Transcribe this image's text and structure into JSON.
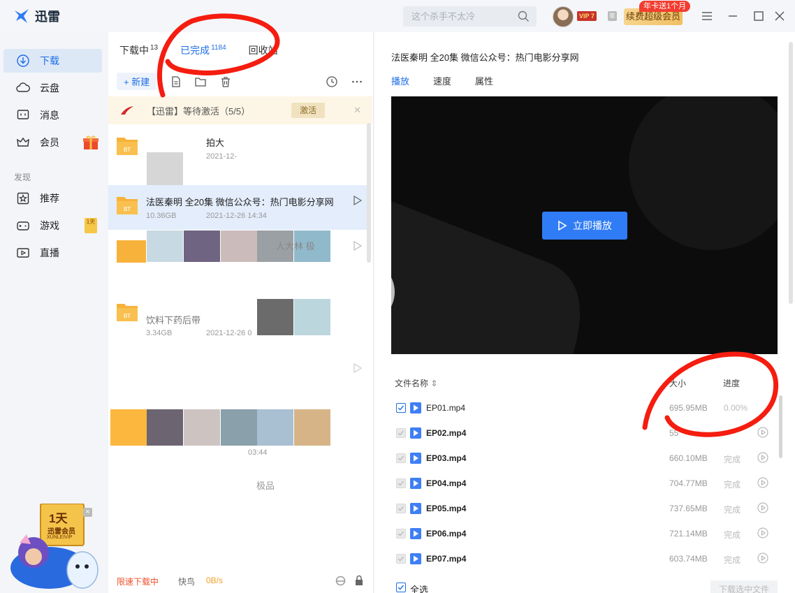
{
  "app": {
    "name": "迅雷"
  },
  "search": {
    "placeholder": "这个杀手不太冷"
  },
  "account": {
    "vip_label": "VIP 7",
    "year_label": "年",
    "renew_label": "续费超级会员",
    "promo_label": "年卡送1个月"
  },
  "sidebar": {
    "items": [
      {
        "label": "下载",
        "icon": "download-icon",
        "active": true
      },
      {
        "label": "云盘",
        "icon": "cloud-icon"
      },
      {
        "label": "消息",
        "icon": "message-icon"
      },
      {
        "label": "会员",
        "icon": "crown-icon"
      }
    ],
    "section": "发现",
    "discover": [
      {
        "label": "推荐",
        "icon": "star-icon"
      },
      {
        "label": "游戏",
        "icon": "gamepad-icon"
      },
      {
        "label": "直播",
        "icon": "live-icon"
      }
    ],
    "game_tag": "1天",
    "ad": {
      "title": "1天",
      "subtitle": "迅雷会员",
      "brand": "XUNLEIVIP"
    }
  },
  "tasks": {
    "tabs": [
      {
        "label": "下载中",
        "count": "13"
      },
      {
        "label": "已完成",
        "count": "1184",
        "active": true
      },
      {
        "label": "回收站",
        "count": ""
      }
    ],
    "new_label": "+ 新建",
    "notice": {
      "text": "【迅雷】等待激活（5/5）",
      "action": "激活"
    },
    "items": [
      {
        "name": "拍大",
        "size": "",
        "date": "2021-12-"
      },
      {
        "name": "法医秦明 全20集 微信公众号：热门电影分享网",
        "size": "10.36GB",
        "date": "2021-12-26 14:34",
        "selected": true
      },
      {
        "name": "人大林 极",
        "size": "",
        "date": ""
      },
      {
        "name": "饮料下药后带",
        "size": "3.34GB",
        "date": "2021-12-26 0"
      },
      {
        "name": "",
        "size": "",
        "date": "03:44"
      },
      {
        "name": "极品",
        "size": "",
        "date": ""
      }
    ],
    "status": {
      "limit": "限速下载中",
      "mode": "快鸟",
      "speed": "0B/s"
    }
  },
  "detail": {
    "title": "法医秦明 全20集 微信公众号：热门电影分享网",
    "tabs": [
      "播放",
      "速度",
      "属性"
    ],
    "play_label": "立即播放",
    "columns": {
      "name": "文件名称",
      "size": "大小",
      "progress": "进度"
    },
    "files": [
      {
        "name": "EP01.mp4",
        "size": "695.95MB",
        "progress": "0.00%"
      },
      {
        "name": "EP02.mp4",
        "size": "55",
        "progress": ""
      },
      {
        "name": "EP03.mp4",
        "size": "660.10MB",
        "progress": "完成"
      },
      {
        "name": "EP04.mp4",
        "size": "704.77MB",
        "progress": "完成"
      },
      {
        "name": "EP05.mp4",
        "size": "737.65MB",
        "progress": "完成"
      },
      {
        "name": "EP06.mp4",
        "size": "721.14MB",
        "progress": "完成"
      },
      {
        "name": "EP07.mp4",
        "size": "603.74MB",
        "progress": "完成"
      }
    ],
    "select_all": "全选",
    "download_selected": "下载选中文件"
  }
}
